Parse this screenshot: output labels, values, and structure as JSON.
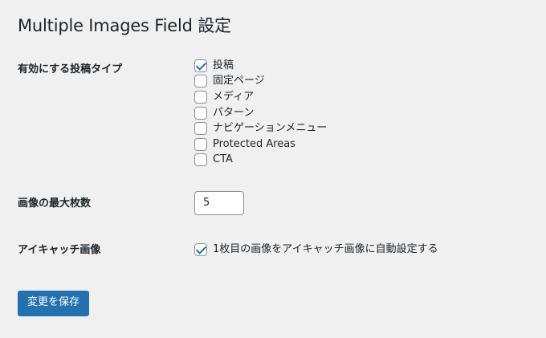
{
  "page": {
    "title": "Multiple Images Field 設定"
  },
  "settings": {
    "post_types": {
      "label": "有効にする投稿タイプ",
      "items": [
        {
          "label": "投稿",
          "checked": true
        },
        {
          "label": "固定ページ",
          "checked": false
        },
        {
          "label": "メディア",
          "checked": false
        },
        {
          "label": "パターン",
          "checked": false
        },
        {
          "label": "ナビゲーションメニュー",
          "checked": false
        },
        {
          "label": "Protected Areas",
          "checked": false
        },
        {
          "label": "CTA",
          "checked": false
        }
      ]
    },
    "max_images": {
      "label": "画像の最大枚数",
      "value": "5"
    },
    "eyecatch": {
      "label": "アイキャッチ画像",
      "checkbox_label": "1枚目の画像をアイキャッチ画像に自動設定する",
      "checked": true
    }
  },
  "actions": {
    "save_label": "変更を保存"
  },
  "colors": {
    "background": "#f0f0f1",
    "accent": "#2271b1",
    "text": "#1d2327",
    "border": "#8c8f94"
  }
}
